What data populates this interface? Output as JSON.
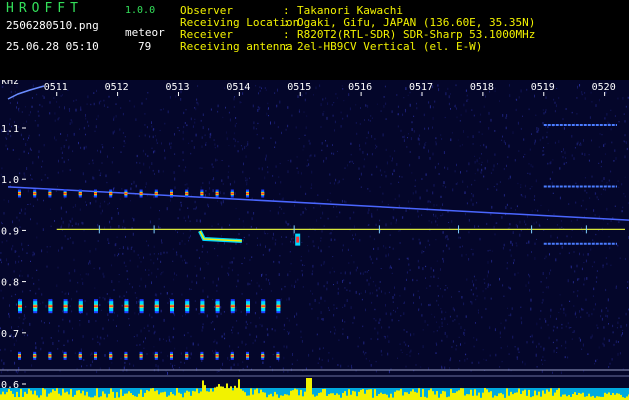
{
  "app": {
    "title": "HROFFT",
    "version": "1.0.0",
    "file_name": "2506280510.png",
    "date_time": "25.06.28 05:10",
    "meteor_label": "meteor",
    "meteor_count": "79"
  },
  "info": [
    {
      "label": "Observer",
      "sep": ":",
      "value": "Takanori Kawachi"
    },
    {
      "label": "Receiving Location",
      "sep": ":",
      "value": "Ogaki, Gifu, JAPAN (136.60E, 35.35N)"
    },
    {
      "label": "Receiver",
      "sep": ":",
      "value": "R820T2(RTL-SDR) SDR-Sharp 53.1000MHz"
    },
    {
      "label": "Receiving antenna",
      "sep": ":",
      "value": "2el-HB9CV Vertical (el. E-W)"
    }
  ],
  "colors": {
    "header_green": "#33e05a",
    "header_yellow": "#f2f200",
    "background": "#04062a",
    "carrier": "#d8e63a",
    "bottom_trace": "#f2f200",
    "bottom_band": "#00c8ff"
  },
  "chart_data": {
    "type": "heatmap",
    "yunit": "kHz",
    "yticks": [
      "1.1",
      "1.0",
      "0.9",
      "0.8",
      "0.7",
      "0.6"
    ],
    "yvalues": [
      1.1,
      1.0,
      0.9,
      0.8,
      0.7,
      0.6
    ],
    "ylim": [
      0.58,
      1.18
    ],
    "xticks": [
      "0511",
      "0512",
      "0513",
      "0514",
      "0515",
      "0516",
      "0517",
      "0518",
      "0519",
      "0520"
    ],
    "xminutes": [
      11,
      12,
      13,
      14,
      15,
      16,
      17,
      18,
      19,
      20
    ],
    "xlim": [
      10.2,
      20.4
    ],
    "carrier_khz": 0.902,
    "drift_line": {
      "start": [
        10.2,
        0.985
      ],
      "end": [
        20.4,
        0.92
      ]
    },
    "pulse_rows_khz": [
      0.972,
      0.752,
      0.655
    ],
    "pulse_rows_end_minute": [
      14.5,
      14.8,
      14.8
    ],
    "meteor_echoes": [
      {
        "minute": 13.45,
        "khz": 0.895
      },
      {
        "minute": 14.95,
        "khz": 0.882
      }
    ],
    "right_traces_khz": [
      1.1,
      0.98,
      0.868
    ]
  }
}
